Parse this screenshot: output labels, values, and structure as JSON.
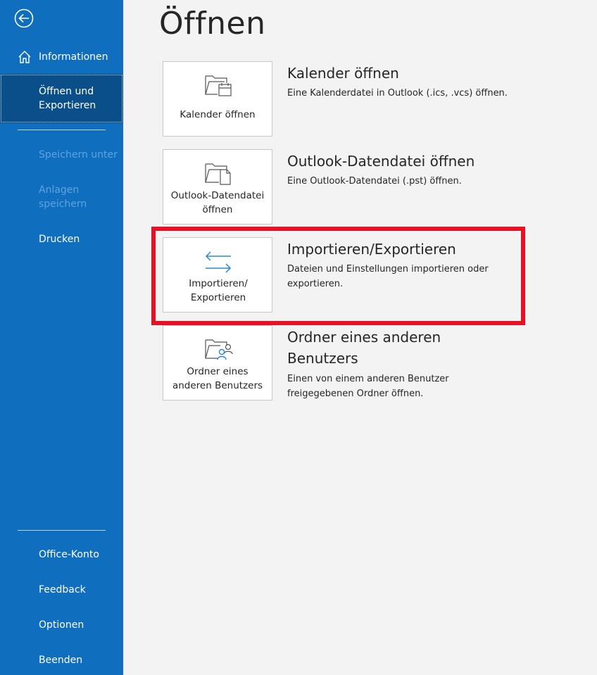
{
  "sidebar": {
    "back_icon": "back-arrow-icon",
    "items": [
      {
        "label": "Informationen",
        "icon": "home-icon",
        "state": "normal"
      },
      {
        "label": "Öffnen und Exportieren",
        "state": "selected"
      },
      {
        "label": "Speichern unter",
        "state": "disabled"
      },
      {
        "label": "Anlagen speichern",
        "state": "disabled"
      },
      {
        "label": "Drucken",
        "state": "normal"
      },
      {
        "label": "Office-Konto",
        "state": "normal"
      },
      {
        "label": "Feedback",
        "state": "normal"
      },
      {
        "label": "Optionen",
        "state": "normal"
      },
      {
        "label": "Beenden",
        "state": "normal"
      }
    ]
  },
  "main": {
    "title": "Öffnen",
    "options": [
      {
        "tile_label": "Kalender öffnen",
        "title": "Kalender öffnen",
        "description": "Eine Kalenderdatei in Outlook (.ics, .vcs) öffnen.",
        "icon": "folder-calendar-icon"
      },
      {
        "tile_label": "Outlook-Datendatei öffnen",
        "title": "Outlook-Datendatei öffnen",
        "description": "Eine Outlook-Datendatei (.pst) öffnen.",
        "icon": "folder-file-icon"
      },
      {
        "tile_label": "Importieren/ Exportieren",
        "title": "Importieren/Exportieren",
        "description": "Dateien und Einstellungen importieren oder exportieren.",
        "icon": "import-export-arrows-icon"
      },
      {
        "tile_label": "Ordner eines anderen Benutzers",
        "title": "Ordner eines anderen Benutzers",
        "description": "Einen von einem anderen Benutzer freigegebenen Ordner öffnen.",
        "icon": "folder-user-icon"
      }
    ]
  },
  "colors": {
    "sidebar_bg": "#106ebe",
    "sidebar_selected": "#0b4f8a",
    "disabled_text": "#5ea3e0",
    "highlight": "#e81123",
    "accent_icon": "#2b88d8"
  }
}
